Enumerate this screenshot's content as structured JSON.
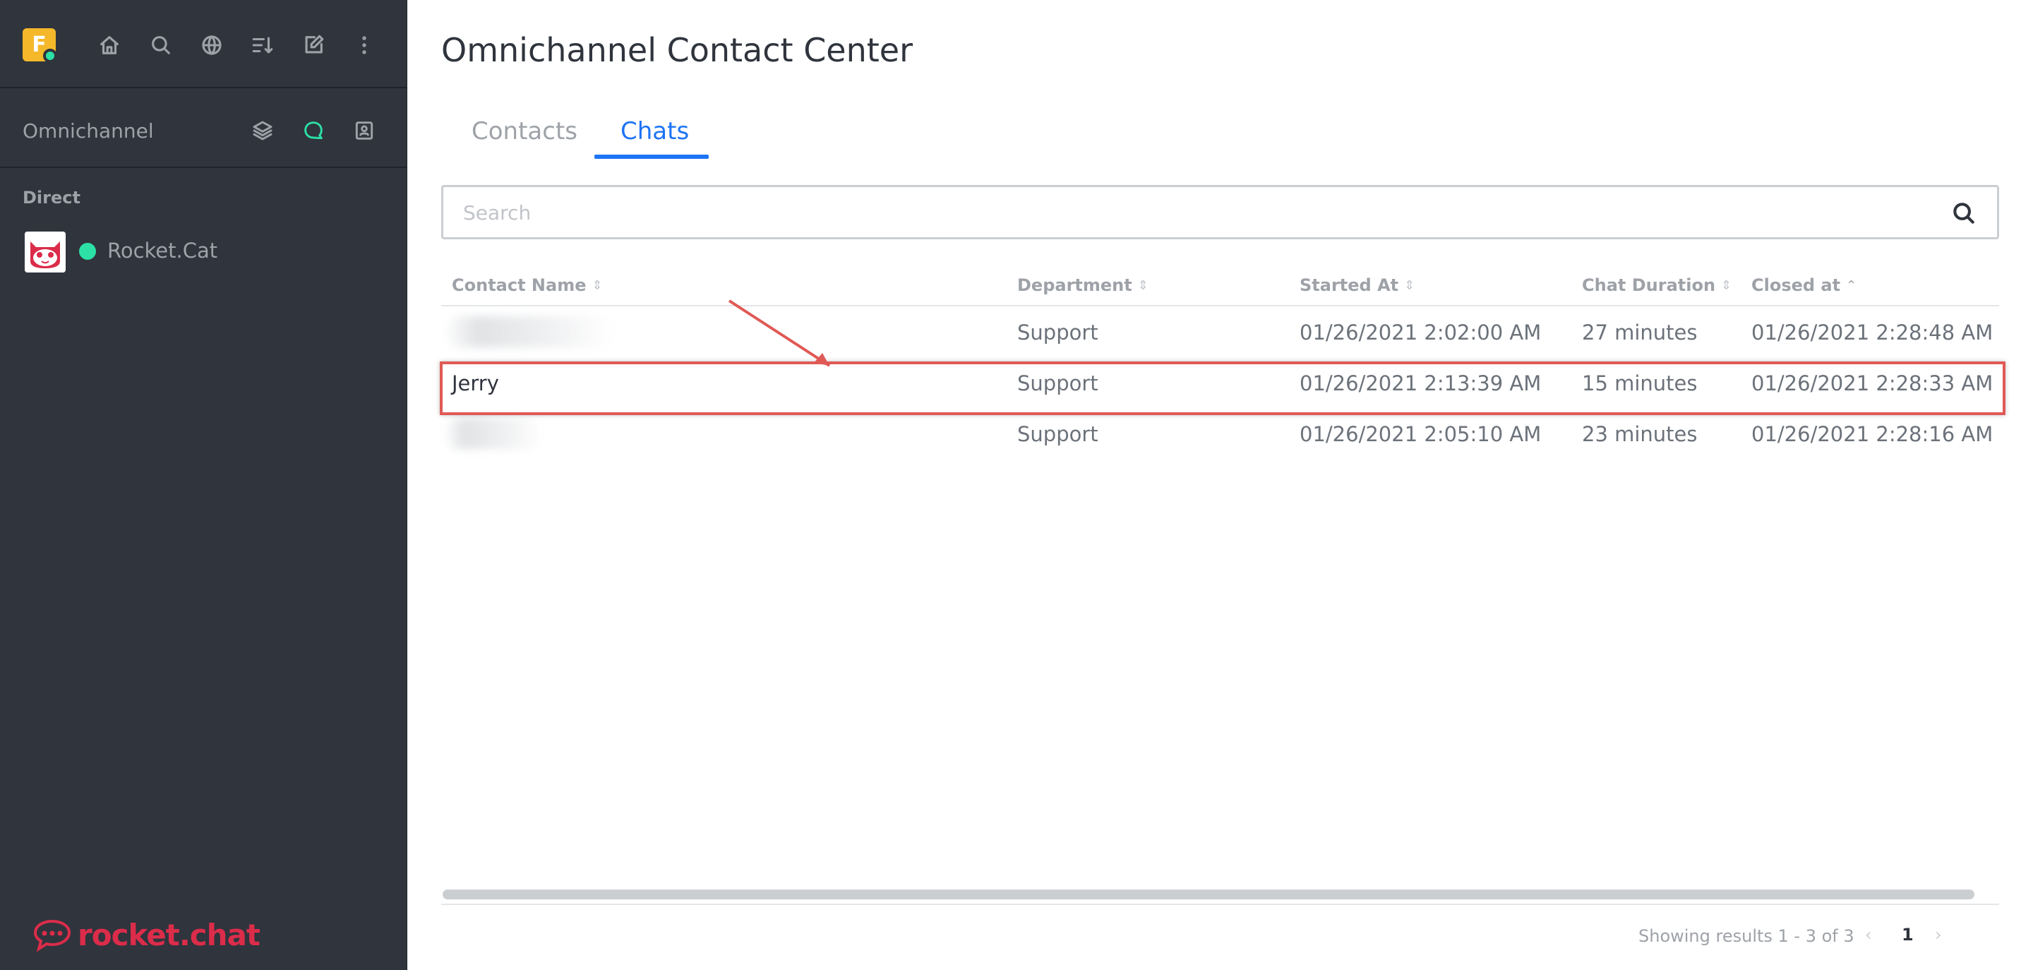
{
  "app": {
    "user_initial": "F",
    "brand": "rocket.chat",
    "colors": {
      "accent": "#1d74f5",
      "sidebar_bg": "#2f343d",
      "online": "#2de0a5",
      "brand": "#db2c4a",
      "highlight": "#e05a55"
    }
  },
  "topbar": {
    "icons": [
      "home-icon",
      "search-icon",
      "directory-icon",
      "sort-icon",
      "create-new-icon",
      "kebab-menu-icon"
    ]
  },
  "sidebar": {
    "omnichannel": {
      "title": "Omnichannel",
      "icons": [
        "queue-icon",
        "chat-active-icon",
        "contact-center-icon"
      ]
    },
    "section_direct": "Direct",
    "direct_items": [
      {
        "name": "Rocket.Cat",
        "status": "online"
      }
    ]
  },
  "main": {
    "title": "Omnichannel Contact Center",
    "tabs": [
      {
        "label": "Contacts",
        "active": false
      },
      {
        "label": "Chats",
        "active": true
      }
    ],
    "search": {
      "placeholder": "Search",
      "value": ""
    },
    "table": {
      "columns": [
        {
          "label": "Contact Name",
          "sort": "none"
        },
        {
          "label": "Department",
          "sort": "none"
        },
        {
          "label": "Started At",
          "sort": "none"
        },
        {
          "label": "Chat Duration",
          "sort": "none"
        },
        {
          "label": "Closed at",
          "sort": "asc"
        }
      ],
      "sort_icon_none": "⇕",
      "sort_icon_asc": "⌃",
      "rows": [
        {
          "contact": "",
          "department": "Support",
          "started": "01/26/2021 2:02:00 AM",
          "duration": "27 minutes",
          "closed": "01/26/2021 2:28:48 AM",
          "name_blurred": true,
          "highlighted": false
        },
        {
          "contact": "Jerry",
          "department": "Support",
          "started": "01/26/2021 2:13:39 AM",
          "duration": "15 minutes",
          "closed": "01/26/2021 2:28:33 AM",
          "name_blurred": false,
          "highlighted": true
        },
        {
          "contact": "",
          "department": "Support",
          "started": "01/26/2021 2:05:10 AM",
          "duration": "23 minutes",
          "closed": "01/26/2021 2:28:16 AM",
          "name_blurred": true,
          "highlighted": false
        }
      ]
    },
    "pagination": {
      "results": "Showing results 1 - 3 of 3",
      "prev": "‹",
      "current": "1",
      "next": "›"
    }
  }
}
